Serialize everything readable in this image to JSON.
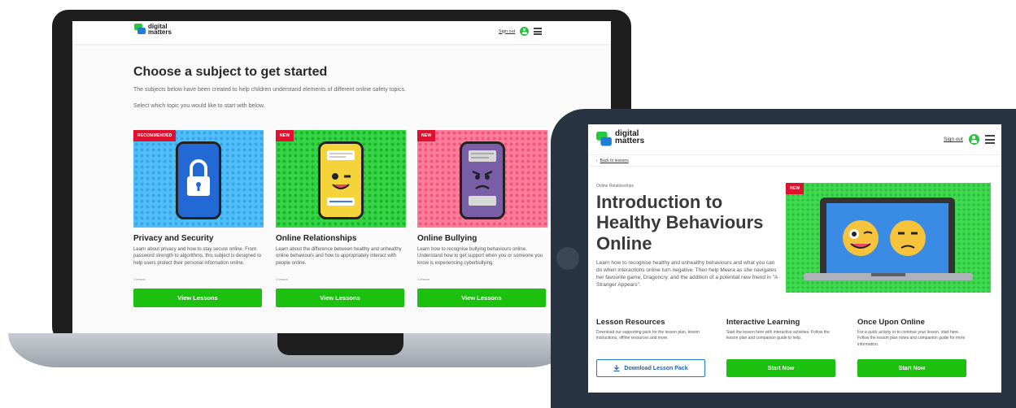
{
  "brand": {
    "logo_line1": "digital",
    "logo_line2": "matters"
  },
  "colors": {
    "accent_green": "#1cc10f",
    "badge_red": "#e0102f",
    "link_blue": "#1e63b8"
  },
  "laptop": {
    "header": {
      "signout": "Sign out"
    },
    "page_title": "Choose a subject to get started",
    "intro_1": "The subjects below have been created to help children understand elements of different online safety topics.",
    "intro_2": "Select which topic you would like to start with below.",
    "cards": [
      {
        "badge": "RECOMMENDED",
        "title": "Privacy and Security",
        "description": "Learn about privacy and how to stay secure online. From password strength to algorithms, this subject is designed to help users protect their personal information online.",
        "count": "1 lesson",
        "button": "View Lessons",
        "icon": "lock-icon"
      },
      {
        "badge": "NEW",
        "title": "Online Relationships",
        "description": "Learn about the difference between healthy and unhealthy online behaviours and how to appropriately interact with people online.",
        "count": "1 lesson",
        "button": "View Lessons",
        "icon": "winking-emoji-icon"
      },
      {
        "badge": "NEW",
        "title": "Online Bullying",
        "description": "Learn how to recognise bullying behaviours online. Understand how to get support when you or someone you know is experiencing cyberbullying.",
        "count": "1 lesson",
        "button": "View Lessons",
        "icon": "angry-emoji-icon"
      }
    ]
  },
  "tablet": {
    "header": {
      "signout": "Sign out"
    },
    "back_link": "Back to lessons",
    "back_glyph": "‹",
    "category": "Online Relationships",
    "title": "Introduction to Healthy Behaviours Online",
    "description": "Learn how to recognise healthy and unhealthy behaviours and what you can do when interactions online turn negative. Then help Meera as she navigates her favourite game, Dragoncry, and the addition of a potential new friend in \"A Stranger Appears\".",
    "hero_badge": "NEW",
    "sections": [
      {
        "title": "Lesson Resources",
        "description": "Download our supporting pack for the lesson plan, lesson instructions, offline resources and more.",
        "button": "Download Lesson Pack",
        "icon": "download-icon"
      },
      {
        "title": "Interactive Learning",
        "description": "Start the lesson here with interactive activities. Follow the lesson plan and companion guide to help.",
        "button": "Start Now"
      },
      {
        "title": "Once Upon Online",
        "description": "For a quick activity or to continue your lesson, start here. Follow the lesson plan notes and companion guide for more information.",
        "button": "Start Now"
      }
    ]
  }
}
